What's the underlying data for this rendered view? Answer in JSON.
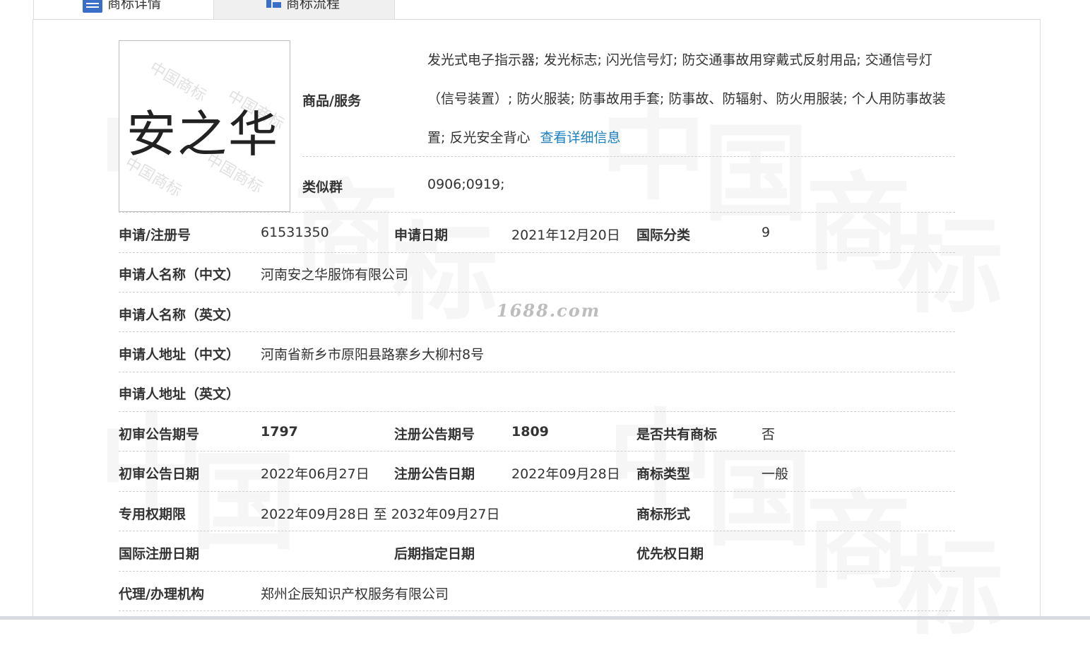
{
  "tabs": [
    {
      "label": "商标详情",
      "icon": "list-icon"
    },
    {
      "label": "商标流程",
      "icon": "chart-icon"
    }
  ],
  "watermark": {
    "chars": [
      "中",
      "国",
      "商",
      "标"
    ],
    "site": "1688.com"
  },
  "logo": {
    "text": "安之华",
    "watermark_text": "中国商标"
  },
  "goods": {
    "label": "商品/服务",
    "text": "发光式电子指示器; 发光标志; 闪光信号灯; 防交通事故用穿戴式反射用品; 交通信号灯（信号装置）; 防火服装; 防事故用手套; 防事故、防辐射、防火用服装; 个人用防事故装置; 反光安全背心",
    "link": "查看详细信息"
  },
  "similar": {
    "label": "类似群",
    "value": "0906;0919;"
  },
  "reg": {
    "no_label": "申请/注册号",
    "no": "61531350",
    "date_label": "申请日期",
    "date": "2021年12月20日",
    "class_label": "国际分类",
    "class": "9"
  },
  "applicant": {
    "name_cn_label": "申请人名称（中文）",
    "name_cn": "河南安之华服饰有限公司",
    "name_en_label": "申请人名称（英文）",
    "name_en": "",
    "addr_cn_label": "申请人地址（中文）",
    "addr_cn": "河南省新乡市原阳县路寨乡大柳村8号",
    "addr_en_label": "申请人地址（英文）",
    "addr_en": ""
  },
  "announce": {
    "prelim_no_label": "初审公告期号",
    "prelim_no": "1797",
    "reg_no_label": "注册公告期号",
    "reg_no": "1809",
    "shared_label": "是否共有商标",
    "shared": "否",
    "prelim_date_label": "初审公告日期",
    "prelim_date": "2022年06月27日",
    "reg_date_label": "注册公告日期",
    "reg_date": "2022年09月28日",
    "type_label": "商标类型",
    "type": "一般"
  },
  "rights": {
    "period_label": "专用权期限",
    "period": "2022年09月28日 至 2032年09月27日",
    "form_label": "商标形式",
    "form": ""
  },
  "dates": {
    "intl_label": "国际注册日期",
    "intl": "",
    "later_label": "后期指定日期",
    "later": "",
    "priority_label": "优先权日期",
    "priority": ""
  },
  "agent": {
    "label": "代理/办理机构",
    "value": "郑州企辰知识产权服务有限公司"
  }
}
